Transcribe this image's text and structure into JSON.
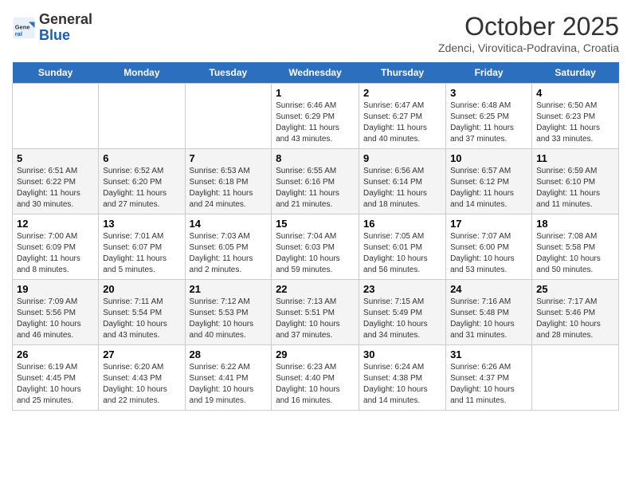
{
  "header": {
    "logo_general": "General",
    "logo_blue": "Blue",
    "month_title": "October 2025",
    "location": "Zdenci, Virovitica-Podravina, Croatia"
  },
  "days_of_week": [
    "Sunday",
    "Monday",
    "Tuesday",
    "Wednesday",
    "Thursday",
    "Friday",
    "Saturday"
  ],
  "weeks": [
    [
      {
        "day": "",
        "info": ""
      },
      {
        "day": "",
        "info": ""
      },
      {
        "day": "",
        "info": ""
      },
      {
        "day": "1",
        "info": "Sunrise: 6:46 AM\nSunset: 6:29 PM\nDaylight: 11 hours\nand 43 minutes."
      },
      {
        "day": "2",
        "info": "Sunrise: 6:47 AM\nSunset: 6:27 PM\nDaylight: 11 hours\nand 40 minutes."
      },
      {
        "day": "3",
        "info": "Sunrise: 6:48 AM\nSunset: 6:25 PM\nDaylight: 11 hours\nand 37 minutes."
      },
      {
        "day": "4",
        "info": "Sunrise: 6:50 AM\nSunset: 6:23 PM\nDaylight: 11 hours\nand 33 minutes."
      }
    ],
    [
      {
        "day": "5",
        "info": "Sunrise: 6:51 AM\nSunset: 6:22 PM\nDaylight: 11 hours\nand 30 minutes."
      },
      {
        "day": "6",
        "info": "Sunrise: 6:52 AM\nSunset: 6:20 PM\nDaylight: 11 hours\nand 27 minutes."
      },
      {
        "day": "7",
        "info": "Sunrise: 6:53 AM\nSunset: 6:18 PM\nDaylight: 11 hours\nand 24 minutes."
      },
      {
        "day": "8",
        "info": "Sunrise: 6:55 AM\nSunset: 6:16 PM\nDaylight: 11 hours\nand 21 minutes."
      },
      {
        "day": "9",
        "info": "Sunrise: 6:56 AM\nSunset: 6:14 PM\nDaylight: 11 hours\nand 18 minutes."
      },
      {
        "day": "10",
        "info": "Sunrise: 6:57 AM\nSunset: 6:12 PM\nDaylight: 11 hours\nand 14 minutes."
      },
      {
        "day": "11",
        "info": "Sunrise: 6:59 AM\nSunset: 6:10 PM\nDaylight: 11 hours\nand 11 minutes."
      }
    ],
    [
      {
        "day": "12",
        "info": "Sunrise: 7:00 AM\nSunset: 6:09 PM\nDaylight: 11 hours\nand 8 minutes."
      },
      {
        "day": "13",
        "info": "Sunrise: 7:01 AM\nSunset: 6:07 PM\nDaylight: 11 hours\nand 5 minutes."
      },
      {
        "day": "14",
        "info": "Sunrise: 7:03 AM\nSunset: 6:05 PM\nDaylight: 11 hours\nand 2 minutes."
      },
      {
        "day": "15",
        "info": "Sunrise: 7:04 AM\nSunset: 6:03 PM\nDaylight: 10 hours\nand 59 minutes."
      },
      {
        "day": "16",
        "info": "Sunrise: 7:05 AM\nSunset: 6:01 PM\nDaylight: 10 hours\nand 56 minutes."
      },
      {
        "day": "17",
        "info": "Sunrise: 7:07 AM\nSunset: 6:00 PM\nDaylight: 10 hours\nand 53 minutes."
      },
      {
        "day": "18",
        "info": "Sunrise: 7:08 AM\nSunset: 5:58 PM\nDaylight: 10 hours\nand 50 minutes."
      }
    ],
    [
      {
        "day": "19",
        "info": "Sunrise: 7:09 AM\nSunset: 5:56 PM\nDaylight: 10 hours\nand 46 minutes."
      },
      {
        "day": "20",
        "info": "Sunrise: 7:11 AM\nSunset: 5:54 PM\nDaylight: 10 hours\nand 43 minutes."
      },
      {
        "day": "21",
        "info": "Sunrise: 7:12 AM\nSunset: 5:53 PM\nDaylight: 10 hours\nand 40 minutes."
      },
      {
        "day": "22",
        "info": "Sunrise: 7:13 AM\nSunset: 5:51 PM\nDaylight: 10 hours\nand 37 minutes."
      },
      {
        "day": "23",
        "info": "Sunrise: 7:15 AM\nSunset: 5:49 PM\nDaylight: 10 hours\nand 34 minutes."
      },
      {
        "day": "24",
        "info": "Sunrise: 7:16 AM\nSunset: 5:48 PM\nDaylight: 10 hours\nand 31 minutes."
      },
      {
        "day": "25",
        "info": "Sunrise: 7:17 AM\nSunset: 5:46 PM\nDaylight: 10 hours\nand 28 minutes."
      }
    ],
    [
      {
        "day": "26",
        "info": "Sunrise: 6:19 AM\nSunset: 4:45 PM\nDaylight: 10 hours\nand 25 minutes."
      },
      {
        "day": "27",
        "info": "Sunrise: 6:20 AM\nSunset: 4:43 PM\nDaylight: 10 hours\nand 22 minutes."
      },
      {
        "day": "28",
        "info": "Sunrise: 6:22 AM\nSunset: 4:41 PM\nDaylight: 10 hours\nand 19 minutes."
      },
      {
        "day": "29",
        "info": "Sunrise: 6:23 AM\nSunset: 4:40 PM\nDaylight: 10 hours\nand 16 minutes."
      },
      {
        "day": "30",
        "info": "Sunrise: 6:24 AM\nSunset: 4:38 PM\nDaylight: 10 hours\nand 14 minutes."
      },
      {
        "day": "31",
        "info": "Sunrise: 6:26 AM\nSunset: 4:37 PM\nDaylight: 10 hours\nand 11 minutes."
      },
      {
        "day": "",
        "info": ""
      }
    ]
  ]
}
